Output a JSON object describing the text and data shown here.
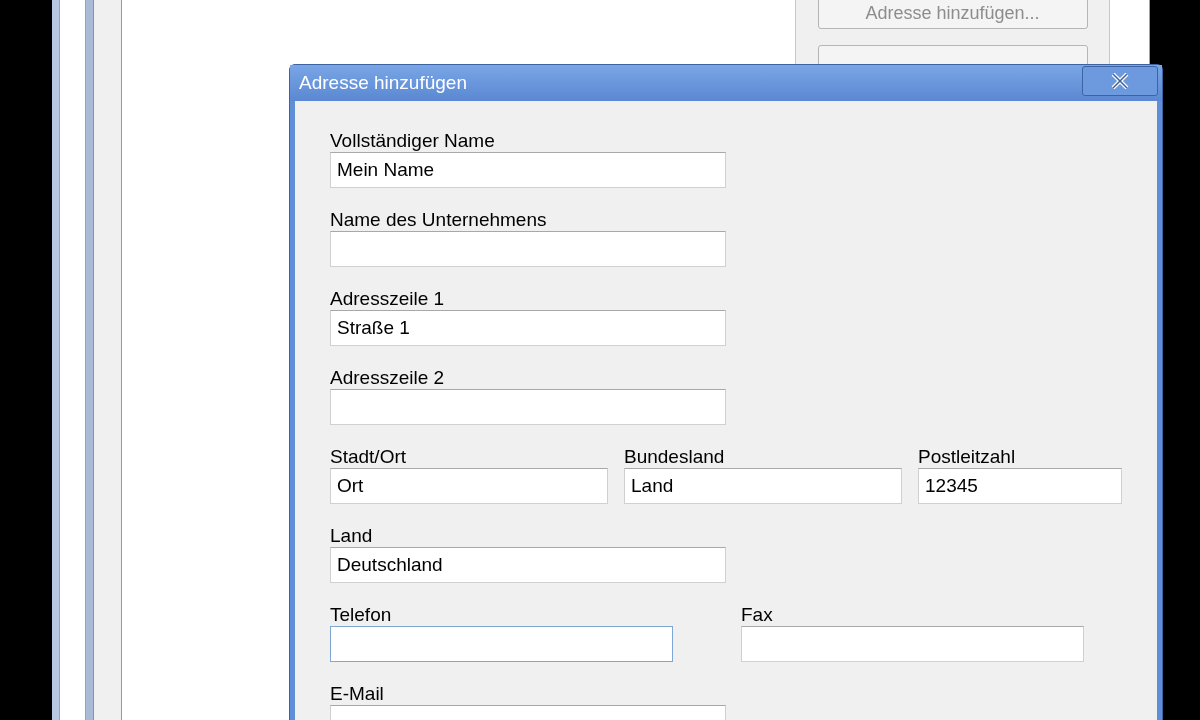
{
  "background_window": {
    "buttons": [
      {
        "label": "Adresse hinzufügen...",
        "disabled": true
      }
    ]
  },
  "dialog": {
    "title": "Adresse hinzufügen",
    "rows": [
      [
        {
          "label": "Vollständiger Name",
          "value": "Mein Name",
          "focused": false
        }
      ],
      [
        {
          "label": "Name des Unternehmens",
          "focused": false
        }
      ],
      [
        {
          "label": "Adresszeile 1",
          "value": "Straße 1",
          "focused": false
        }
      ],
      [
        {
          "label": "Adresszeile 2",
          "focused": false
        }
      ],
      [
        {
          "label": "Stadt/Ort",
          "value": "Ort",
          "focused": false
        },
        {
          "label": "Bundesland",
          "value": "Land",
          "focused": false
        },
        {
          "label": "Postleitzahl",
          "value": "12345",
          "focused": false
        }
      ],
      [
        {
          "label": "Land",
          "value": "Deutschland",
          "focused": false
        }
      ],
      [
        {
          "label": "Telefon",
          "focused": true
        },
        {
          "label": "Fax",
          "focused": false
        }
      ],
      [
        {
          "label": "E-Mail",
          "focused": false
        }
      ]
    ]
  }
}
